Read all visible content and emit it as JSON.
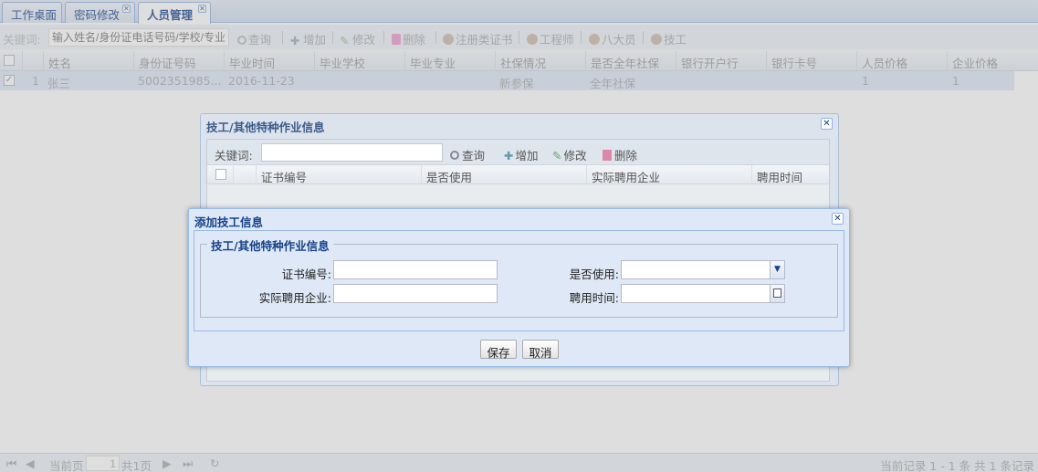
{
  "tabs": [
    {
      "label": "工作桌面",
      "closable": false,
      "active": false
    },
    {
      "label": "密码修改",
      "closable": true,
      "active": false
    },
    {
      "label": "人员管理",
      "closable": true,
      "active": true
    }
  ],
  "search": {
    "label": "关键词:",
    "placeholder": "输入姓名/身份证电话号码/学校/专业",
    "buttons": [
      "查询",
      "增加",
      "修改",
      "删除",
      "注册类证书",
      "工程师",
      "八大员",
      "技工"
    ]
  },
  "grid": {
    "columns": [
      "姓名",
      "身份证号码",
      "毕业时间",
      "毕业学校",
      "毕业专业",
      "社保情况",
      "是否全年社保",
      "银行开户行",
      "银行卡号",
      "人员价格",
      "企业价格"
    ],
    "rows": [
      {
        "index": "1",
        "checked": true,
        "cells": [
          "张三",
          "5002351985...",
          "2016-11-23",
          "",
          "",
          "新参保",
          "全年社保",
          "",
          "",
          "1",
          "1"
        ]
      }
    ]
  },
  "paging": {
    "current_label": "当前页",
    "page_value": "1",
    "total_label": "共1页",
    "summary": "当前记录 1 - 1 条 共 1 条记录"
  },
  "skill_window": {
    "title": "技工/其他特种作业信息",
    "keyword_label": "关键词:",
    "buttons": [
      "查询",
      "增加",
      "修改",
      "删除"
    ],
    "columns": [
      "证书编号",
      "是否使用",
      "实际聘用企业",
      "聘用时间"
    ]
  },
  "add_dialog": {
    "title": "添加技工信息",
    "fieldset_title": "技工/其他特种作业信息",
    "fields": {
      "cert_no": {
        "label": "证书编号:",
        "value": ""
      },
      "in_use": {
        "label": "是否使用:",
        "value": ""
      },
      "company": {
        "label": "实际聘用企业:",
        "value": ""
      },
      "hire_date": {
        "label": "聘用时间:",
        "value": ""
      }
    },
    "save_label": "保存",
    "cancel_label": "取消"
  },
  "colors": {
    "header_text": "#15428b",
    "window_bg": "#dfe8f6",
    "border": "#99bbe8"
  }
}
